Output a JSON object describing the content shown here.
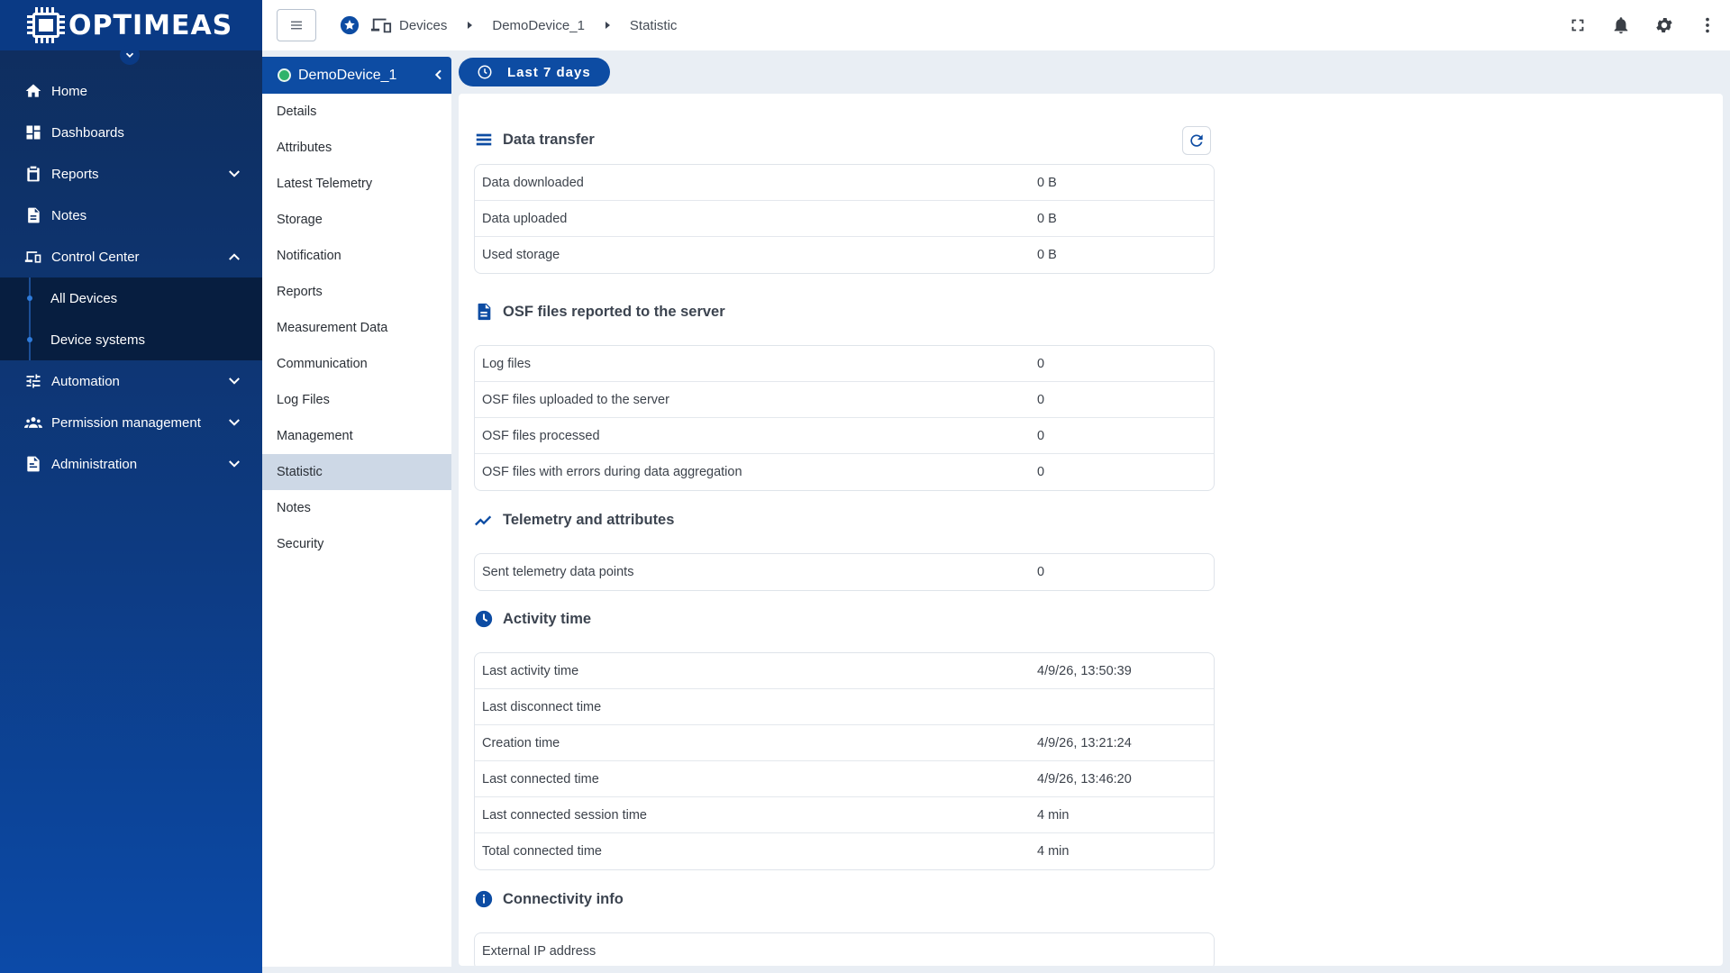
{
  "app": {
    "brand": "OPTIMEAS"
  },
  "sidebar": {
    "items": [
      {
        "label": "Home",
        "icon": "home-icon"
      },
      {
        "label": "Dashboards",
        "icon": "dashboards-icon"
      },
      {
        "label": "Reports",
        "icon": "clipboard-icon",
        "expandable": true
      },
      {
        "label": "Notes",
        "icon": "note-icon"
      },
      {
        "label": "Control Center",
        "icon": "devices-icon",
        "expanded": true
      },
      {
        "label": "Automation",
        "icon": "tune-icon",
        "expandable": true
      },
      {
        "label": "Permission management",
        "icon": "people-icon",
        "expandable": true
      },
      {
        "label": "Administration",
        "icon": "admin-doc-icon",
        "expandable": true
      }
    ],
    "control_center_children": [
      "All Devices",
      "Device systems"
    ]
  },
  "breadcrumb": {
    "devices": "Devices",
    "device": "DemoDevice_1",
    "page": "Statistic"
  },
  "device_panel": {
    "title": "DemoDevice_1",
    "status_color": "#2fb36b",
    "items": [
      "Details",
      "Attributes",
      "Latest Telemetry",
      "Storage",
      "Notification",
      "Reports",
      "Measurement Data",
      "Communication",
      "Log Files",
      "Management",
      "Statistic",
      "Notes",
      "Security"
    ],
    "active": "Statistic"
  },
  "time_range": {
    "label": "Last 7 days"
  },
  "sections": {
    "data_transfer": {
      "title": "Data transfer",
      "rows": [
        {
          "k": "Data downloaded",
          "v": "0 B"
        },
        {
          "k": "Data uploaded",
          "v": "0 B"
        },
        {
          "k": "Used storage",
          "v": "0 B"
        }
      ]
    },
    "osf": {
      "title": "OSF files reported to the server",
      "rows": [
        {
          "k": "Log files",
          "v": "0"
        },
        {
          "k": "OSF files uploaded to the server",
          "v": "0"
        },
        {
          "k": "OSF files processed",
          "v": "0"
        },
        {
          "k": "OSF files with errors during data aggregation",
          "v": "0"
        }
      ]
    },
    "telemetry": {
      "title": "Telemetry and attributes",
      "rows": [
        {
          "k": "Sent telemetry data points",
          "v": "0"
        }
      ]
    },
    "activity": {
      "title": "Activity time",
      "rows": [
        {
          "k": "Last activity time",
          "v": "4/9/26, 13:50:39"
        },
        {
          "k": "Last disconnect time",
          "v": ""
        },
        {
          "k": "Creation time",
          "v": "4/9/26, 13:21:24"
        },
        {
          "k": "Last connected time",
          "v": "4/9/26, 13:46:20"
        },
        {
          "k": "Last connected session time",
          "v": "4 min"
        },
        {
          "k": "Total connected time",
          "v": "4 min"
        }
      ]
    },
    "connectivity": {
      "title": "Connectivity info",
      "rows": [
        {
          "k": "External IP address",
          "v": ""
        }
      ]
    }
  },
  "colors": {
    "primary": "#0d4ca3",
    "sidebar_top": "#0f2d5c",
    "active_item": "#cdd8e6"
  }
}
